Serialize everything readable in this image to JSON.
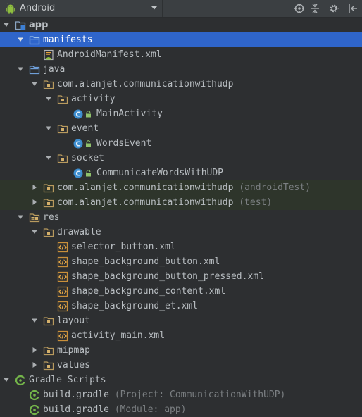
{
  "toolbar": {
    "view_label": "Android",
    "icons": [
      "android-icon",
      "chevron-down-icon",
      "target-icon",
      "collapse-icon",
      "gear-icon",
      "hide-icon"
    ],
    "colors": {
      "toolbar_bg": "#3b3f42",
      "tree_bg": "#2d2f31",
      "selected_bg": "#2f65ca",
      "test_bg": "#2e352b"
    }
  },
  "tree": [
    {
      "id": "app",
      "label": "app",
      "hint": ""
    },
    {
      "id": "manifests",
      "label": "manifests",
      "hint": ""
    },
    {
      "id": "android-manifest",
      "label": "AndroidManifest.xml",
      "hint": ""
    },
    {
      "id": "java",
      "label": "java",
      "hint": ""
    },
    {
      "id": "pkg-main",
      "label": "com.alanjet.communicationwithudp",
      "hint": ""
    },
    {
      "id": "pkg-activity",
      "label": "activity",
      "hint": ""
    },
    {
      "id": "main-activity",
      "label": "MainActivity",
      "hint": ""
    },
    {
      "id": "pkg-event",
      "label": "event",
      "hint": ""
    },
    {
      "id": "words-event",
      "label": "WordsEvent",
      "hint": ""
    },
    {
      "id": "pkg-socket",
      "label": "socket",
      "hint": ""
    },
    {
      "id": "communicate-words",
      "label": "CommunicateWordsWithUDP",
      "hint": ""
    },
    {
      "id": "pkg-android-test",
      "label": "com.alanjet.communicationwithudp",
      "hint": "(androidTest)"
    },
    {
      "id": "pkg-test",
      "label": "com.alanjet.communicationwithudp",
      "hint": "(test)"
    },
    {
      "id": "res",
      "label": "res",
      "hint": ""
    },
    {
      "id": "drawable",
      "label": "drawable",
      "hint": ""
    },
    {
      "id": "selector-button",
      "label": "selector_button.xml",
      "hint": ""
    },
    {
      "id": "shape-bg-button",
      "label": "shape_background_button.xml",
      "hint": ""
    },
    {
      "id": "shape-bg-button-pressed",
      "label": "shape_background_button_pressed.xml",
      "hint": ""
    },
    {
      "id": "shape-bg-content",
      "label": "shape_background_content.xml",
      "hint": ""
    },
    {
      "id": "shape-bg-et",
      "label": "shape_background_et.xml",
      "hint": ""
    },
    {
      "id": "layout",
      "label": "layout",
      "hint": ""
    },
    {
      "id": "activity-main",
      "label": "activity_main.xml",
      "hint": ""
    },
    {
      "id": "mipmap",
      "label": "mipmap",
      "hint": ""
    },
    {
      "id": "values",
      "label": "values",
      "hint": ""
    },
    {
      "id": "gradle-scripts",
      "label": "Gradle Scripts",
      "hint": ""
    },
    {
      "id": "build-gradle-project",
      "label": "build.gradle",
      "hint": "(Project: CommunicationWithUDP)"
    },
    {
      "id": "build-gradle-module",
      "label": "build.gradle",
      "hint": "(Module: app)"
    }
  ]
}
